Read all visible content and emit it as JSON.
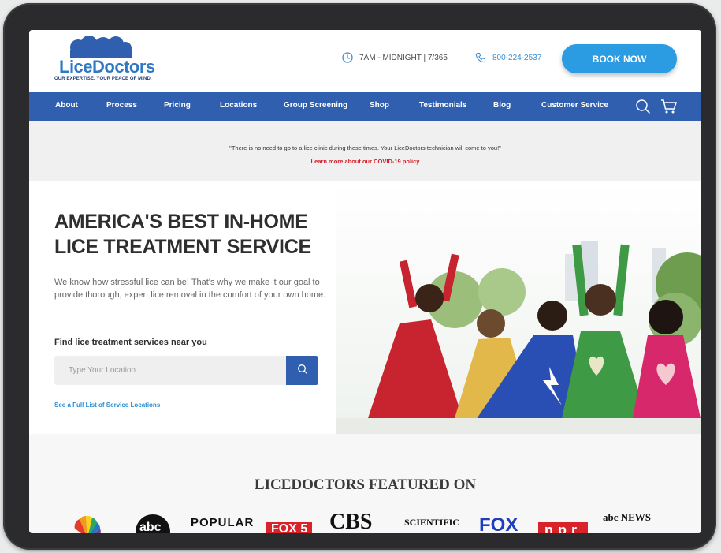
{
  "header": {
    "brand": "LiceDoctors",
    "tagline": "OUR EXPERTISE. YOUR PEACE OF MIND.",
    "hours": "7AM - MIDNIGHT | 7/365",
    "phone": "800-224-2537",
    "book_label": "BOOK NOW"
  },
  "nav": {
    "items": [
      "About",
      "Process",
      "Pricing",
      "Locations",
      "Group Screening",
      "Shop",
      "Testimonials",
      "Blog",
      "Customer Service"
    ]
  },
  "notice": {
    "quote": "\"There is no need to go to a lice clinic during these times. Your LiceDoctors technician will come to you!\"",
    "link": "Learn more about our COVID-19 policy"
  },
  "hero": {
    "title_line1": "AMERICA'S BEST IN-HOME",
    "title_line2": "LICE TREATMENT SERVICE",
    "description": "We know how stressful lice can be! That's why we make it our goal to provide thorough, expert lice removal in the comfort of your own home.",
    "find_label": "Find lice treatment services near you",
    "search_placeholder": "Type Your Location",
    "full_list_link": "See a Full List of Service Locations"
  },
  "featured": {
    "title": "LICEDOCTORS FEATURED ON",
    "logos": [
      "abc",
      "POPULAR",
      "FOX 5",
      "CBS",
      "SCIENTIFIC",
      "FOX",
      "npr",
      "abc NEWS"
    ]
  },
  "colors": {
    "nav_blue": "#2f5fae",
    "button_blue": "#2b9be2",
    "link_red": "#d4202a"
  }
}
